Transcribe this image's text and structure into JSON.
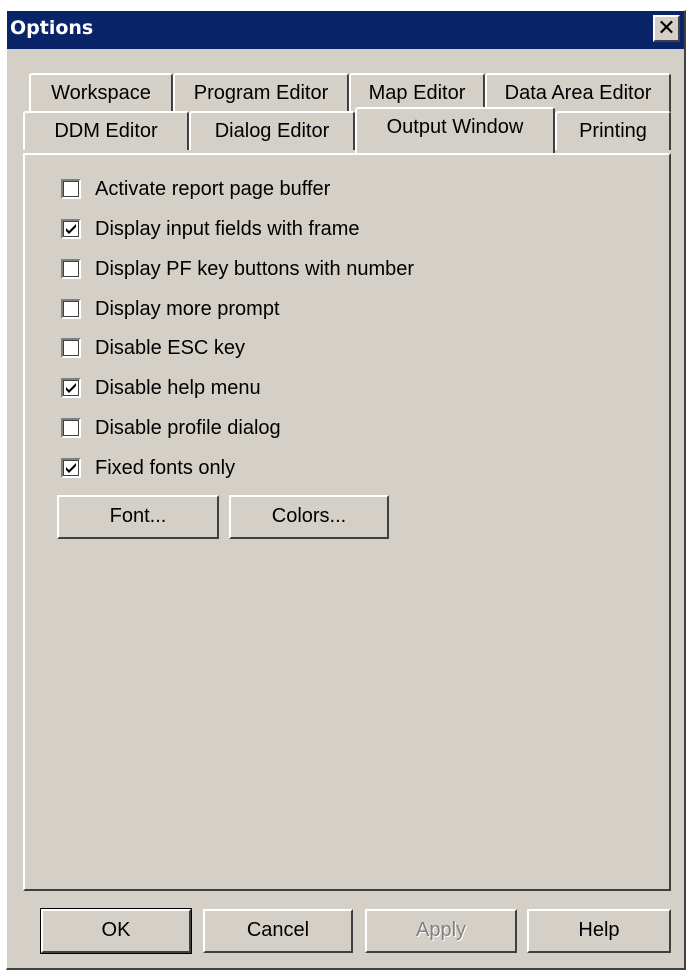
{
  "window": {
    "title": "Options",
    "close_glyph": "✕"
  },
  "tabs": {
    "row1": [
      "Workspace",
      "Program Editor",
      "Map Editor",
      "Data Area Editor"
    ],
    "row2": [
      "DDM Editor",
      "Dialog Editor",
      "Output Window",
      "Printing"
    ],
    "active": "Output Window"
  },
  "options": [
    {
      "label": "Activate report page buffer",
      "checked": false
    },
    {
      "label": "Display input fields with frame",
      "checked": true
    },
    {
      "label": "Display PF key buttons with number",
      "checked": false
    },
    {
      "label": "Display more prompt",
      "checked": false
    },
    {
      "label": "Disable ESC key",
      "checked": false
    },
    {
      "label": "Disable help menu",
      "checked": true
    },
    {
      "label": "Disable profile dialog",
      "checked": false
    },
    {
      "label": "Fixed fonts only",
      "checked": true
    }
  ],
  "panel_buttons": {
    "font": "Font...",
    "colors": "Colors..."
  },
  "footer": {
    "ok": "OK",
    "cancel": "Cancel",
    "apply": "Apply",
    "help": "Help"
  }
}
